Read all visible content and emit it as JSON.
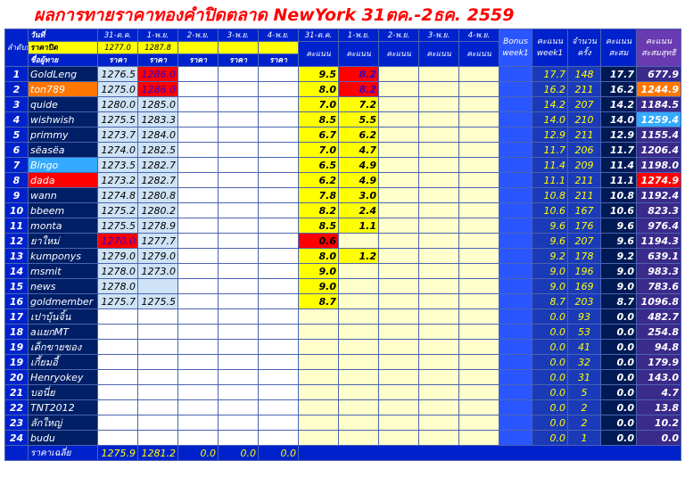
{
  "title": "ผลการทายราคาทองคำปิดตลาด NewYork 31ตค.-2ธค. 2559",
  "header": {
    "rank_label": "ลำดับที่",
    "date_label": "วันที่",
    "close_label": "ราคาปิด",
    "name_label": "ชื่อผู้ทาย",
    "price_label": "ราคา",
    "score_label": "คะแนน",
    "dates": [
      "31-ต.ค.",
      "1-พ.ย.",
      "2-พ.ย.",
      "3-พ.ย.",
      "4-พ.ย."
    ],
    "close_prices": [
      "1277.0",
      "1287.8",
      "",
      "",
      ""
    ],
    "bonus_label_1": "Bonus",
    "bonus_label_2": "week1",
    "w1_label_1": "คะแนน",
    "w1_label_2": "week1",
    "count_label_1": "จำนวน",
    "count_label_2": "ครั้ง",
    "accum_label_1": "คะแนน",
    "accum_label_2": "สะสม",
    "total_label_1": "คะแนน",
    "total_label_2": "สะสมสุทธิ"
  },
  "rows": [
    {
      "rank": "1",
      "name": "GoldLeng",
      "p": [
        "1276.5",
        "1286.0",
        "",
        "",
        ""
      ],
      "s": [
        "9.5",
        "8.2",
        "",
        "",
        ""
      ],
      "w1": "17.7",
      "cnt": "148",
      "accum": "17.7",
      "total": "677.9"
    },
    {
      "rank": "2",
      "name": "ton789",
      "p": [
        "1275.0",
        "1286.0",
        "",
        "",
        ""
      ],
      "s": [
        "8.0",
        "8.2",
        "",
        "",
        ""
      ],
      "w1": "16.2",
      "cnt": "211",
      "accum": "16.2",
      "total": "1244.9"
    },
    {
      "rank": "3",
      "name": "quide",
      "p": [
        "1280.0",
        "1285.0",
        "",
        "",
        ""
      ],
      "s": [
        "7.0",
        "7.2",
        "",
        "",
        ""
      ],
      "w1": "14.2",
      "cnt": "207",
      "accum": "14.2",
      "total": "1184.5"
    },
    {
      "rank": "4",
      "name": "wishwish",
      "p": [
        "1275.5",
        "1283.3",
        "",
        "",
        ""
      ],
      "s": [
        "8.5",
        "5.5",
        "",
        "",
        ""
      ],
      "w1": "14.0",
      "cnt": "210",
      "accum": "14.0",
      "total": "1259.4"
    },
    {
      "rank": "5",
      "name": "primmy",
      "p": [
        "1273.7",
        "1284.0",
        "",
        "",
        ""
      ],
      "s": [
        "6.7",
        "6.2",
        "",
        "",
        ""
      ],
      "w1": "12.9",
      "cnt": "211",
      "accum": "12.9",
      "total": "1155.4"
    },
    {
      "rank": "6",
      "name": "sëasëa",
      "p": [
        "1274.0",
        "1282.5",
        "",
        "",
        ""
      ],
      "s": [
        "7.0",
        "4.7",
        "",
        "",
        ""
      ],
      "w1": "11.7",
      "cnt": "206",
      "accum": "11.7",
      "total": "1206.4"
    },
    {
      "rank": "7",
      "name": "Bingo",
      "p": [
        "1273.5",
        "1282.7",
        "",
        "",
        ""
      ],
      "s": [
        "6.5",
        "4.9",
        "",
        "",
        ""
      ],
      "w1": "11.4",
      "cnt": "209",
      "accum": "11.4",
      "total": "1198.0"
    },
    {
      "rank": "8",
      "name": "dada",
      "p": [
        "1273.2",
        "1282.7",
        "",
        "",
        ""
      ],
      "s": [
        "6.2",
        "4.9",
        "",
        "",
        ""
      ],
      "w1": "11.1",
      "cnt": "211",
      "accum": "11.1",
      "total": "1274.9"
    },
    {
      "rank": "9",
      "name": "wann",
      "p": [
        "1274.8",
        "1280.8",
        "",
        "",
        ""
      ],
      "s": [
        "7.8",
        "3.0",
        "",
        "",
        ""
      ],
      "w1": "10.8",
      "cnt": "211",
      "accum": "10.8",
      "total": "1192.4"
    },
    {
      "rank": "10",
      "name": "bbeem",
      "p": [
        "1275.2",
        "1280.2",
        "",
        "",
        ""
      ],
      "s": [
        "8.2",
        "2.4",
        "",
        "",
        ""
      ],
      "w1": "10.6",
      "cnt": "167",
      "accum": "10.6",
      "total": "823.3"
    },
    {
      "rank": "11",
      "name": "monta",
      "p": [
        "1275.5",
        "1278.9",
        "",
        "",
        ""
      ],
      "s": [
        "8.5",
        "1.1",
        "",
        "",
        ""
      ],
      "w1": "9.6",
      "cnt": "176",
      "accum": "9.6",
      "total": "976.4"
    },
    {
      "rank": "12",
      "name": "ยาใหม่",
      "p": [
        "1270.0",
        "1277.7",
        "",
        "",
        ""
      ],
      "s": [
        "0.6",
        "",
        "",
        "",
        ""
      ],
      "w1": "9.6",
      "cnt": "207",
      "accum": "9.6",
      "total": "1194.3"
    },
    {
      "rank": "13",
      "name": "kumponys",
      "p": [
        "1279.0",
        "1279.0",
        "",
        "",
        ""
      ],
      "s": [
        "8.0",
        "1.2",
        "",
        "",
        ""
      ],
      "w1": "9.2",
      "cnt": "178",
      "accum": "9.2",
      "total": "639.1"
    },
    {
      "rank": "14",
      "name": "msmit",
      "p": [
        "1278.0",
        "1273.0",
        "",
        "",
        ""
      ],
      "s": [
        "9.0",
        "",
        "",
        "",
        ""
      ],
      "w1": "9.0",
      "cnt": "196",
      "accum": "9.0",
      "total": "983.3"
    },
    {
      "rank": "15",
      "name": "news",
      "p": [
        "1278.0",
        "",
        "",
        "",
        ""
      ],
      "s": [
        "9.0",
        "",
        "",
        "",
        ""
      ],
      "w1": "9.0",
      "cnt": "169",
      "accum": "9.0",
      "total": "783.6"
    },
    {
      "rank": "16",
      "name": "goldmember",
      "p": [
        "1275.7",
        "1275.5",
        "",
        "",
        ""
      ],
      "s": [
        "8.7",
        "",
        "",
        "",
        ""
      ],
      "w1": "8.7",
      "cnt": "203",
      "accum": "8.7",
      "total": "1096.8"
    },
    {
      "rank": "17",
      "name": "เปาบุ้นจิ้น",
      "p": [
        "",
        "",
        "",
        "",
        ""
      ],
      "s": [
        "",
        "",
        "",
        "",
        ""
      ],
      "w1": "0.0",
      "cnt": "93",
      "accum": "0.0",
      "total": "482.7"
    },
    {
      "rank": "18",
      "name": "aแยกMT",
      "p": [
        "",
        "",
        "",
        "",
        ""
      ],
      "s": [
        "",
        "",
        "",
        "",
        ""
      ],
      "w1": "0.0",
      "cnt": "53",
      "accum": "0.0",
      "total": "254.8"
    },
    {
      "rank": "19",
      "name": "เด็กขายของ",
      "p": [
        "",
        "",
        "",
        "",
        ""
      ],
      "s": [
        "",
        "",
        "",
        "",
        ""
      ],
      "w1": "0.0",
      "cnt": "41",
      "accum": "0.0",
      "total": "94.8"
    },
    {
      "rank": "19",
      "name": "เกี้ยมอี้",
      "p": [
        "",
        "",
        "",
        "",
        ""
      ],
      "s": [
        "",
        "",
        "",
        "",
        ""
      ],
      "w1": "0.0",
      "cnt": "32",
      "accum": "0.0",
      "total": "179.9"
    },
    {
      "rank": "20",
      "name": "Henryokey",
      "p": [
        "",
        "",
        "",
        "",
        ""
      ],
      "s": [
        "",
        "",
        "",
        "",
        ""
      ],
      "w1": "0.0",
      "cnt": "31",
      "accum": "0.0",
      "total": "143.0"
    },
    {
      "rank": "21",
      "name": "บอนี่ย",
      "p": [
        "",
        "",
        "",
        "",
        ""
      ],
      "s": [
        "",
        "",
        "",
        "",
        ""
      ],
      "w1": "0.0",
      "cnt": "5",
      "accum": "0.0",
      "total": "4.7"
    },
    {
      "rank": "22",
      "name": "TNT2012",
      "p": [
        "",
        "",
        "",
        "",
        ""
      ],
      "s": [
        "",
        "",
        "",
        "",
        ""
      ],
      "w1": "0.0",
      "cnt": "2",
      "accum": "0.0",
      "total": "13.8"
    },
    {
      "rank": "23",
      "name": "ลักใหญ่",
      "p": [
        "",
        "",
        "",
        "",
        ""
      ],
      "s": [
        "",
        "",
        "",
        "",
        ""
      ],
      "w1": "0.0",
      "cnt": "2",
      "accum": "0.0",
      "total": "10.2"
    },
    {
      "rank": "24",
      "name": "budu",
      "p": [
        "",
        "",
        "",
        "",
        ""
      ],
      "s": [
        "",
        "",
        "",
        "",
        ""
      ],
      "w1": "0.0",
      "cnt": "1",
      "accum": "0.0",
      "total": "0.0"
    }
  ],
  "footer": {
    "avg_label": "ราคาเฉลี่ย",
    "avg_values": [
      "1275.9",
      "1281.2",
      "0.0",
      "0.0",
      "0.0"
    ]
  },
  "highlights": {
    "red": "#ff0000",
    "orange": "#ff7700",
    "skyblue": "#33aaff",
    "yellow": "#ffff00",
    "header_blue": "#0022cc"
  }
}
